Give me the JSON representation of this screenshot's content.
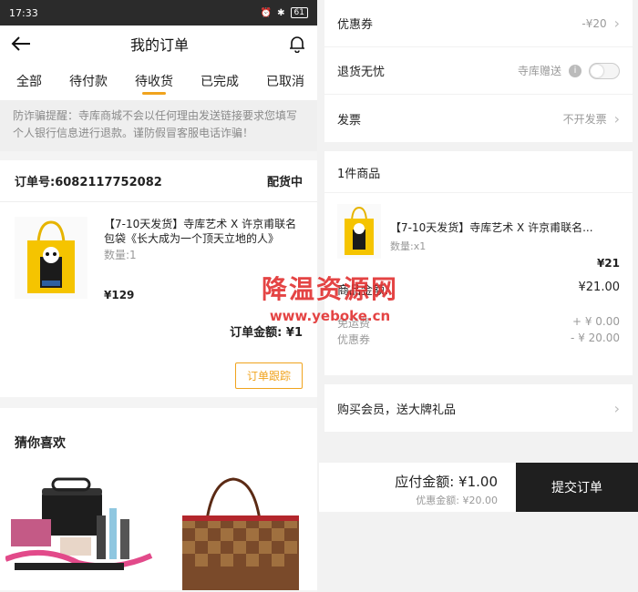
{
  "left": {
    "status": {
      "time": "17:33",
      "signal": "…",
      "battery": "61"
    },
    "header": {
      "title": "我的订单"
    },
    "tabs": [
      "全部",
      "待付款",
      "待收货",
      "已完成",
      "已取消"
    ],
    "notice": "防诈骗提醒：寺库商城不会以任何理由发送链接要求您填写个人银行信息进行退款。谨防假冒客服电话诈骗！",
    "order": {
      "number": "订单号:6082117752082",
      "status": "配货中",
      "product_name": "【7-10天发货】寺库艺术 X 许京甫联名包袋《长大成为一个顶天立地的人》",
      "qty": "数量:1",
      "price": "¥129",
      "total": "订单金额: ¥1",
      "track_button": "订单跟踪"
    },
    "guess": {
      "title": "猜你喜欢"
    }
  },
  "right": {
    "rows": {
      "coupon": {
        "label": "优惠券",
        "value": "-¥20"
      },
      "return": {
        "label": "退货无忧",
        "value": "寺库赠送"
      },
      "invoice": {
        "label": "发票",
        "value": "不开发票"
      }
    },
    "goods": {
      "count": "1件商品",
      "name": "【7-10天发货】寺库艺术 X 许京甫联名...",
      "qty": "数量:x1",
      "price": "¥21",
      "sum_label": "商品金额:",
      "sum_value": "¥21.00",
      "freight_label": "免运费",
      "freight_value": "+ ¥ 0.00",
      "coupon_label": "优惠券",
      "coupon_value": "- ¥ 20.00"
    },
    "member": {
      "label": "购买会员，送大牌礼品"
    },
    "bottom": {
      "pay": "应付金额: ¥1.00",
      "discount": "优惠金额: ¥20.00",
      "submit": "提交订单"
    }
  },
  "watermark": {
    "cn": "降温资源网",
    "url": "www.yeboke.cn"
  },
  "colors": {
    "accent": "#f0a31d",
    "dark": "#1f1f1f",
    "watermark": "#e23030"
  }
}
